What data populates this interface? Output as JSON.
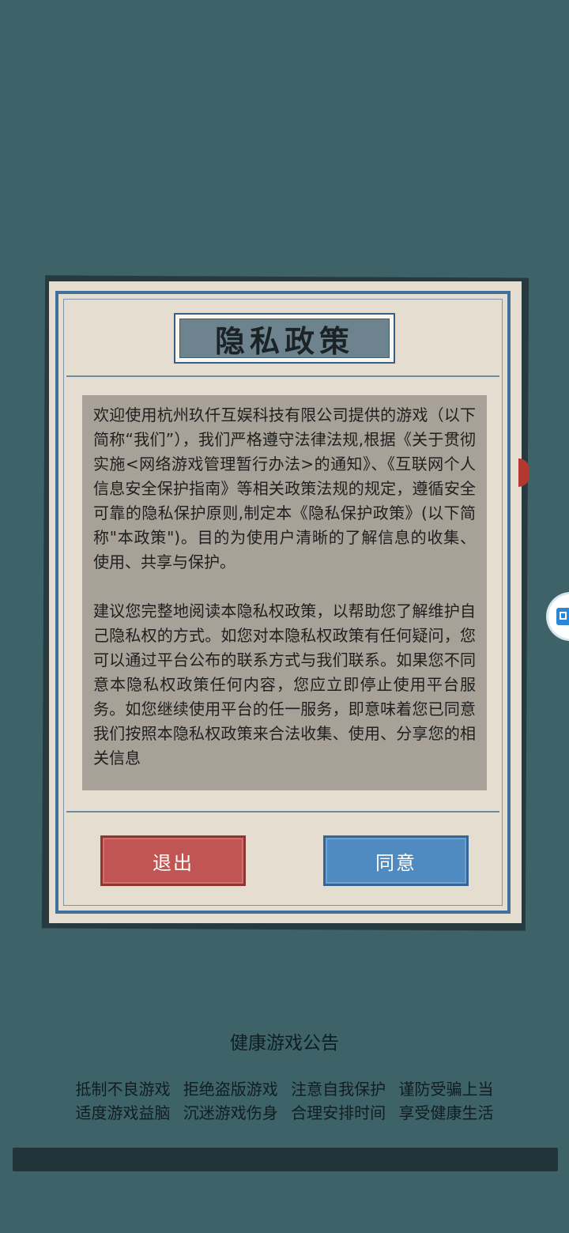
{
  "dialog": {
    "title": "隐私政策",
    "paragraphs": [
      "欢迎使用杭州玖仟互娱科技有限公司提供的游戏（以下简称“我们”），我们严格遵守法律法规,根据《关于贯彻实施<网络游戏管理暂行办法>的通知》、《互联网个人信息安全保护指南》等相关政策法规的规定，遵循安全可靠的隐私保护原则,制定本《隐私保护政策》(以下简称\"本政策\")。目的为使用户清晰的了解信息的收集、使用、共享与保护。",
      "建议您完整地阅读本隐私权政策，以帮助您了解维护自己隐私权的方式。如您对本隐私权政策有任何疑问，您可以通过平台公布的联系方式与我们联系。如果您不同意本隐私权政策任何内容，您应立即停止使用平台服务。如您继续使用平台的任一服务，即意味着您已同意我们按照本隐私权政策来合法收集、使用、分享您的相关信息"
    ],
    "exit_label": "退出",
    "agree_label": "同意"
  },
  "health_notice": {
    "title": "健康游戏公告",
    "line1": "抵制不良游戏 拒绝盗版游戏 注意自我保护 谨防受骗上当",
    "line2": "适度游戏益脑 沉迷游戏伤身 合理安排时间 享受健康生活"
  },
  "colors": {
    "background": "#3d6268",
    "exit_button": "#c15553",
    "agree_button": "#4f8ac0"
  }
}
